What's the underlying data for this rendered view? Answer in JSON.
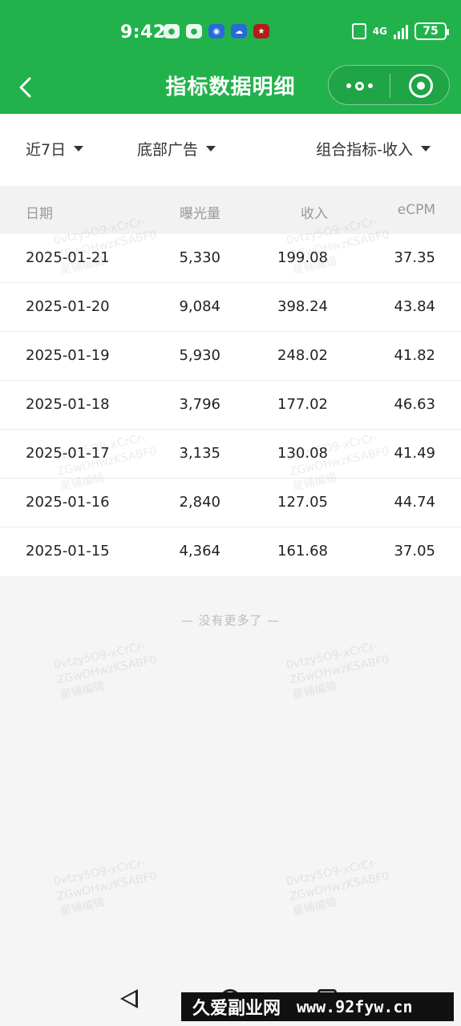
{
  "status_bar": {
    "time": "9:42",
    "network": "4G",
    "battery": "75"
  },
  "nav": {
    "title": "指标数据明细"
  },
  "filters": {
    "range": "近7日",
    "ad_type": "底部广告",
    "metric": "组合指标-收入"
  },
  "table": {
    "headers": {
      "date": "日期",
      "impressions": "曝光量",
      "revenue": "收入",
      "ecpm": "eCPM"
    },
    "rows": [
      {
        "date": "2025-01-21",
        "impressions": "5,330",
        "revenue": "199.08",
        "ecpm": "37.35"
      },
      {
        "date": "2025-01-20",
        "impressions": "9,084",
        "revenue": "398.24",
        "ecpm": "43.84"
      },
      {
        "date": "2025-01-19",
        "impressions": "5,930",
        "revenue": "248.02",
        "ecpm": "41.82"
      },
      {
        "date": "2025-01-18",
        "impressions": "3,796",
        "revenue": "177.02",
        "ecpm": "46.63"
      },
      {
        "date": "2025-01-17",
        "impressions": "3,135",
        "revenue": "130.08",
        "ecpm": "41.49"
      },
      {
        "date": "2025-01-16",
        "impressions": "2,840",
        "revenue": "127.05",
        "ecpm": "44.74"
      },
      {
        "date": "2025-01-15",
        "impressions": "4,364",
        "revenue": "161.68",
        "ecpm": "37.05"
      }
    ]
  },
  "footer": {
    "no_more": "— 没有更多了 —"
  },
  "watermark": {
    "text": "0vtzy5O9-xCrCr-\nZGwOHwzKSABF0\n星铺编辑"
  },
  "banner": {
    "name": "久爱副业网",
    "url": "www.92fyw.cn"
  }
}
